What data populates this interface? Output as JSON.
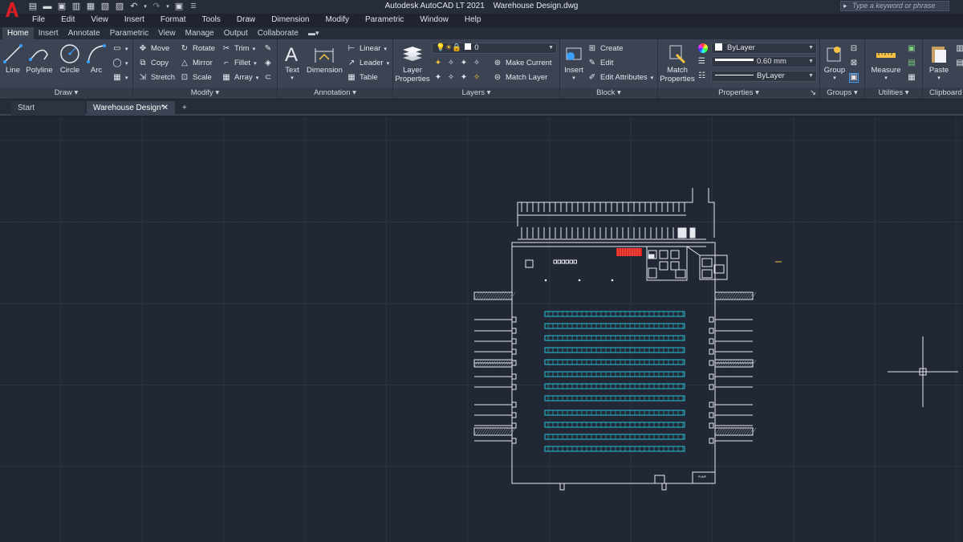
{
  "app": {
    "name": "Autodesk AutoCAD LT 2021",
    "document": "Warehouse Design.dwg"
  },
  "search": {
    "placeholder": "Type a keyword or phrase"
  },
  "menu": [
    "File",
    "Edit",
    "View",
    "Insert",
    "Format",
    "Tools",
    "Draw",
    "Dimension",
    "Modify",
    "Parametric",
    "Window",
    "Help"
  ],
  "ribbon_tabs": [
    "Home",
    "Insert",
    "Annotate",
    "Parametric",
    "View",
    "Manage",
    "Output",
    "Collaborate"
  ],
  "active_ribbon_tab": "Home",
  "panels": {
    "draw": {
      "title": "Draw",
      "line": "Line",
      "polyline": "Polyline",
      "circle": "Circle",
      "arc": "Arc"
    },
    "modify": {
      "title": "Modify",
      "move": "Move",
      "rotate": "Rotate",
      "trim": "Trim",
      "copy": "Copy",
      "mirror": "Mirror",
      "fillet": "Fillet",
      "stretch": "Stretch",
      "scale": "Scale",
      "array": "Array"
    },
    "annotation": {
      "title": "Annotation",
      "text": "Text",
      "dimension": "Dimension",
      "linear": "Linear",
      "leader": "Leader",
      "table": "Table"
    },
    "layers": {
      "title": "Layers",
      "layer_properties": "Layer Properties",
      "current_layer": "0",
      "make_current": "Make Current",
      "match_layer": "Match Layer"
    },
    "block": {
      "title": "Block",
      "insert": "Insert",
      "create": "Create",
      "edit": "Edit",
      "edit_attributes": "Edit Attributes"
    },
    "properties": {
      "title": "Properties",
      "match_properties": "Match Properties",
      "color": "ByLayer",
      "lineweight": "0.60 mm",
      "linetype": "ByLayer"
    },
    "groups": {
      "title": "Groups",
      "group": "Group"
    },
    "utilities": {
      "title": "Utilities",
      "measure": "Measure"
    },
    "clipboard": {
      "title": "Clipboard",
      "paste": "Paste"
    }
  },
  "doc_tabs": [
    "Start",
    "Warehouse Design*"
  ],
  "active_doc_tab": "Warehouse Design*",
  "colors": {
    "canvas": "#212735",
    "grid": "#2c3444",
    "outline": "#e6e9ef",
    "racks": "#27c3d6",
    "highlight": "#e0201a",
    "ribbon": "#3c4352"
  }
}
